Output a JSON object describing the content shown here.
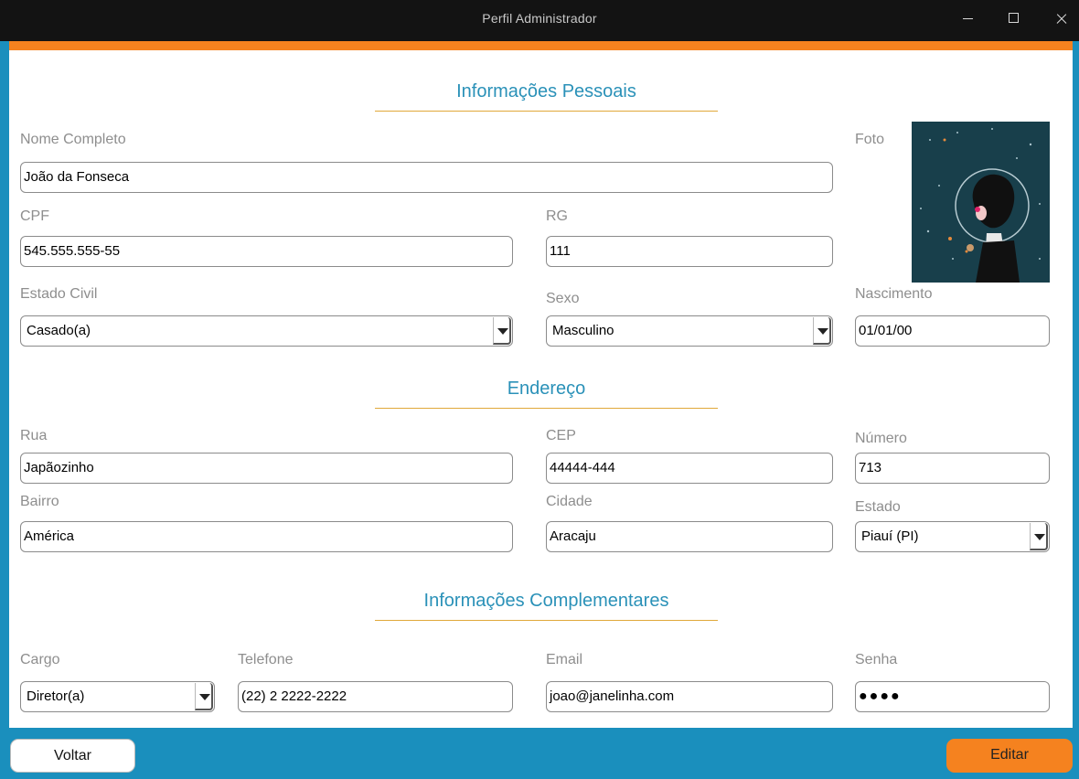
{
  "window": {
    "title": "Perfil Administrador"
  },
  "sections": {
    "personal": "Informações Pessoais",
    "address": "Endereço",
    "complementary": "Informações Complementares"
  },
  "personal": {
    "nome_label": "Nome Completo",
    "nome_value": "João da Fonseca",
    "foto_label": "Foto",
    "cpf_label": "CPF",
    "cpf_value": "545.555.555-55",
    "rg_label": "RG",
    "rg_value": "111",
    "estado_civil_label": "Estado Civil",
    "estado_civil_value": "Casado(a)",
    "sexo_label": "Sexo",
    "sexo_value": "Masculino",
    "nascimento_label": "Nascimento",
    "nascimento_value": "01/01/00"
  },
  "address": {
    "rua_label": "Rua",
    "rua_value": "Japãozinho",
    "cep_label": "CEP",
    "cep_value": "44444-444",
    "numero_label": "Número",
    "numero_value": "713",
    "bairro_label": "Bairro",
    "bairro_value": "América",
    "cidade_label": "Cidade",
    "cidade_value": "Aracaju",
    "estado_label": "Estado",
    "estado_value": "Piauí (PI)"
  },
  "complementary": {
    "cargo_label": "Cargo",
    "cargo_value": "Diretor(a)",
    "telefone_label": "Telefone",
    "telefone_value": "(22) 2 2222-2222",
    "email_label": "Email",
    "email_value": "joao@janelinha.com",
    "senha_label": "Senha",
    "senha_value": "●●●●"
  },
  "buttons": {
    "back": "Voltar",
    "edit": "Editar"
  },
  "colors": {
    "accent_orange": "#f5821f",
    "background_blue": "#1a8fbd",
    "section_title": "#2a91b8"
  }
}
